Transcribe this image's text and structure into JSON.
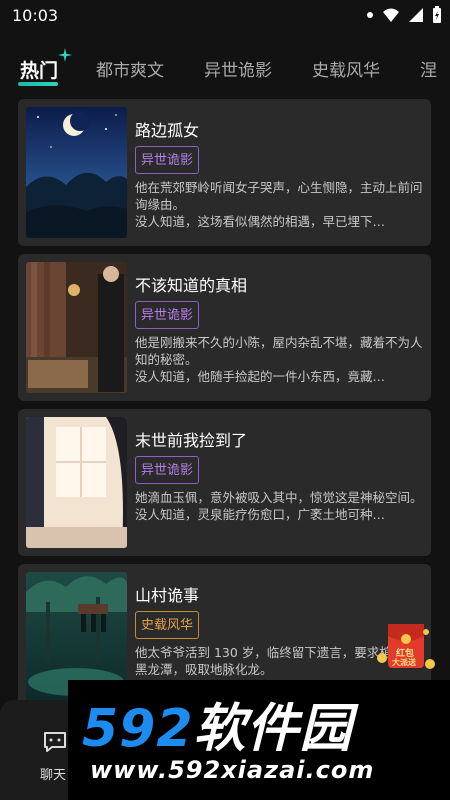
{
  "status": {
    "time": "10:03"
  },
  "tabs": [
    {
      "label": "热门"
    },
    {
      "label": "都市爽文"
    },
    {
      "label": "异世诡影"
    },
    {
      "label": "史载风华"
    },
    {
      "label": "涅"
    }
  ],
  "cards": [
    {
      "title": "路边孤女",
      "tag": "异世诡影",
      "desc1": "他在荒郊野岭听闻女子哭声，心生恻隐，主动上前问询缘由。",
      "desc2": "没人知道，这场看似偶然的相遇，早已埋下…"
    },
    {
      "title": "不该知道的真相",
      "tag": "异世诡影",
      "desc1": "他是刚搬来不久的小陈，屋内杂乱不堪，藏着不为人知的秘密。",
      "desc2": "没人知道，他随手捡起的一件小东西，竟藏…"
    },
    {
      "title": "末世前我捡到了",
      "tag": "异世诡影",
      "desc1": "她滴血玉佩，意外被吸入其中，惊觉这是神秘空间。",
      "desc2": "没人知道，灵泉能疗伤愈口，广袤土地可种…"
    },
    {
      "title": "山村诡事",
      "tag": "史载风华",
      "desc1": "他太爷爷活到 130 岁，临终留下遗言，要求棺沉入黑龙潭，吸取地脉化龙。",
      "desc2": ""
    }
  ],
  "bottom_nav": {
    "label": "聊天"
  },
  "watermark": {
    "big_num": "592",
    "big_text": "软件园",
    "url": "www.592xiazai.com"
  },
  "redpack": {
    "line1": "红包",
    "line2": "大派送"
  },
  "colors": {
    "accent": "#1fb5a8",
    "tag_purple": "#b57ee8",
    "tag_orange": "#e0a14a"
  }
}
